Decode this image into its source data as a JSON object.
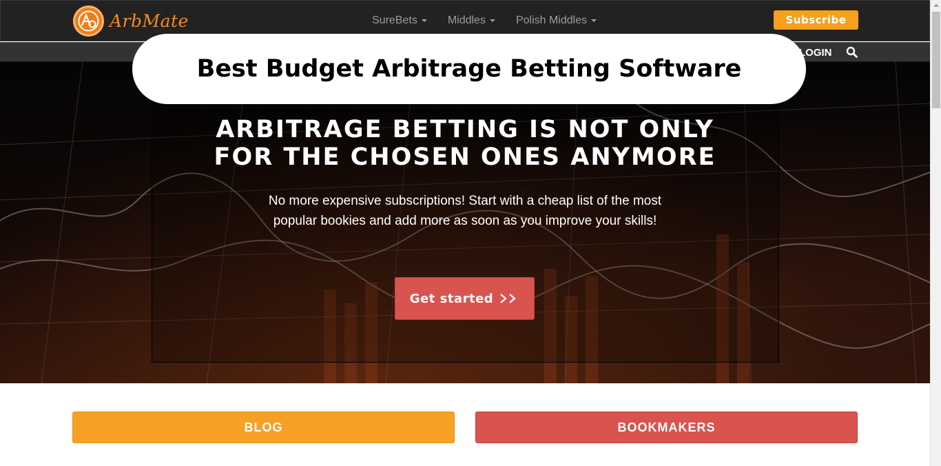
{
  "brand": {
    "name": "ArbMate",
    "logo_letters": "AB",
    "accent_color": "#f48b22"
  },
  "nav": {
    "items": [
      {
        "label": "SureBets",
        "icon": "chevron-down-icon"
      },
      {
        "label": "Middles",
        "icon": "chevron-down-icon"
      },
      {
        "label": "Polish Middles",
        "icon": "chevron-down-icon"
      }
    ],
    "subscribe_label": "Subscribe"
  },
  "subnav": {
    "login_label": "LOGIN",
    "search_icon": "search-icon"
  },
  "banner": {
    "text": "Best Budget Arbitrage Betting Software"
  },
  "hero": {
    "title_line1": "ARBITRAGE BETTING IS NOT ONLY",
    "title_line2": "FOR THE CHOSEN ONES ANYMORE",
    "description": "No more expensive subscriptions! Start with a cheap list of the most popular bookies and add more as soon as you improve your skills!",
    "cta_label": "Get started",
    "cta_icon": "double-chevron-right-icon"
  },
  "sections": {
    "blog_label": "BLOG",
    "bookmakers_label": "BOOKMAKERS"
  },
  "colors": {
    "orange": "#f6a024",
    "red": "#d9534f",
    "navbar": "#222222"
  }
}
